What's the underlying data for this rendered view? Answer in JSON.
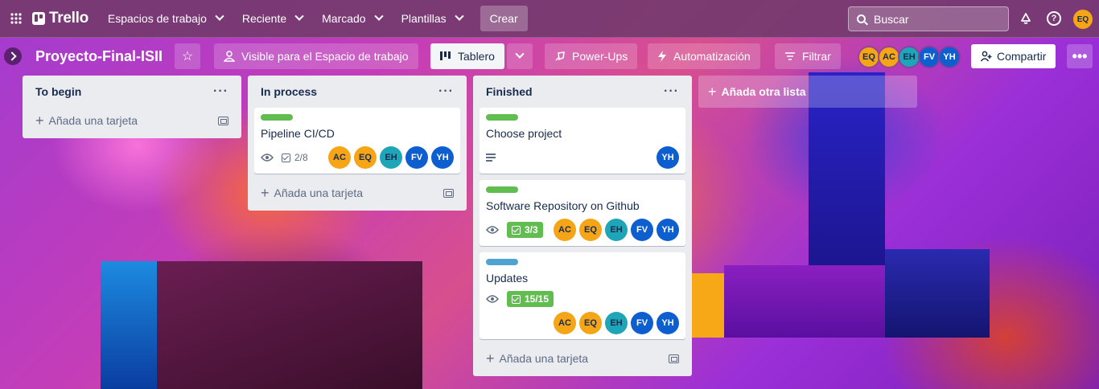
{
  "colors": {
    "green_label": "#61bd4f",
    "blue_label": "#4ea3d0",
    "orange_member": "#f5a516",
    "teal_member": "#1fa5b8",
    "blue_member": "#0d5fcf"
  },
  "topbar": {
    "logo": "Trello",
    "nav": [
      "Espacios de trabajo",
      "Reciente",
      "Marcado",
      "Plantillas"
    ],
    "create": "Crear",
    "search_placeholder": "Buscar",
    "me_initials": "EQ"
  },
  "board": {
    "title": "Proyecto-Final-ISII",
    "visibility": "Visible para el Espacio de trabajo",
    "view": "Tablero",
    "powerups": "Power-Ups",
    "automation": "Automatización",
    "filter": "Filtrar",
    "members": [
      "EQ",
      "AC",
      "EH",
      "FV",
      "YH"
    ],
    "share": "Compartir",
    "more": "•••"
  },
  "lists": [
    {
      "title": "To begin",
      "add_card": "Añada una tarjeta"
    },
    {
      "title": "In process",
      "add_card": "Añada una tarjeta",
      "cards": [
        {
          "title": "Pipeline CI/CD",
          "checklist": "2/8",
          "members": [
            "AC",
            "EQ",
            "EH",
            "FV",
            "YH"
          ]
        }
      ]
    },
    {
      "title": "Finished",
      "add_card": "Añada una tarjeta",
      "cards": [
        {
          "title": "Choose project",
          "members": [
            "YH"
          ]
        },
        {
          "title": "Software Repository on Github",
          "checklist": "3/3",
          "members": [
            "AC",
            "EQ",
            "EH",
            "FV",
            "YH"
          ]
        },
        {
          "title": "Updates",
          "checklist": "15/15",
          "members": [
            "AC",
            "EQ",
            "EH",
            "FV",
            "YH"
          ]
        }
      ]
    }
  ],
  "add_list": "Añada otra lista"
}
